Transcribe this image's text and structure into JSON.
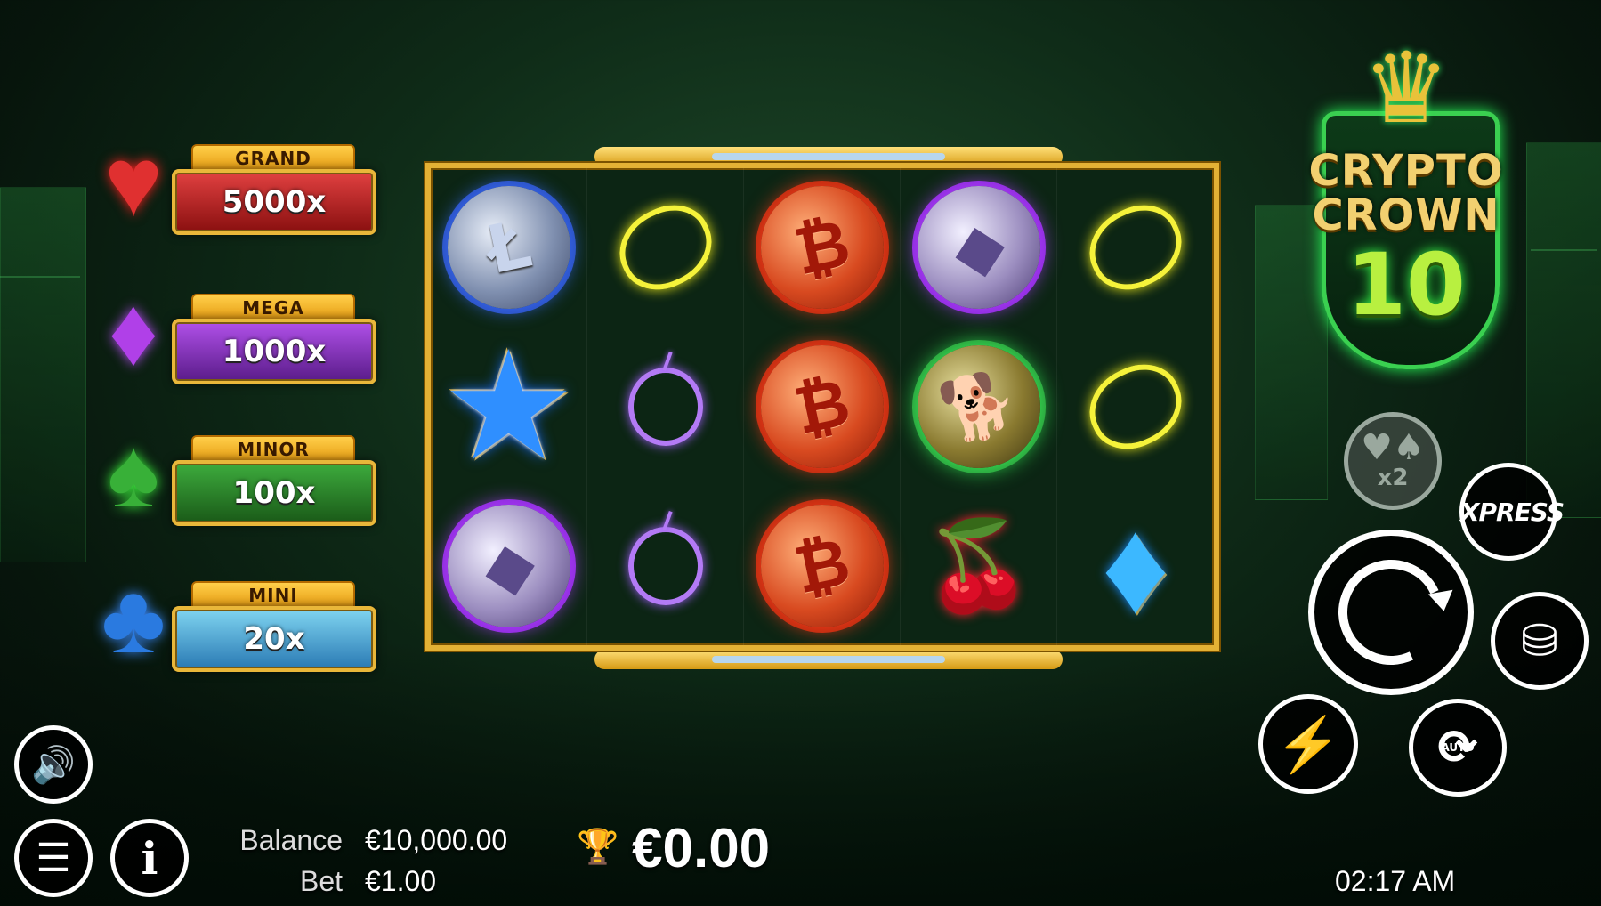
{
  "jackpots": [
    {
      "name": "GRAND",
      "value": "5000x",
      "suit": "♥",
      "color": "#e03030"
    },
    {
      "name": "MEGA",
      "value": "1000x",
      "suit": "♦",
      "color": "#b040e8"
    },
    {
      "name": "MINOR",
      "value": "100x",
      "suit": "♠",
      "color": "#38b038"
    },
    {
      "name": "MINI",
      "value": "20x",
      "suit": "♣",
      "color": "#2a7ae0"
    }
  ],
  "reels": [
    [
      "litecoin-coin",
      "star-symbol",
      "ethereum-coin"
    ],
    [
      "lemon-symbol",
      "plum-symbol",
      "plum-symbol"
    ],
    [
      "bitcoin-coin",
      "bitcoin-coin",
      "bitcoin-coin"
    ],
    [
      "ethereum-coin",
      "dogecoin-coin",
      "cherry-symbol"
    ],
    [
      "lemon-symbol",
      "lemon-symbol",
      "diamond-symbol"
    ]
  ],
  "logo": {
    "line1": "CRYPTO",
    "line2": "CROWN",
    "number": "10"
  },
  "controls": {
    "double_up": "x2",
    "xpress": "XPRESS",
    "auto": "AUTO"
  },
  "status": {
    "balance_label": "Balance",
    "balance_value": "€10,000.00",
    "bet_label": "Bet",
    "bet_value": "€1.00",
    "win_value": "€0.00",
    "clock": "02:17 AM"
  },
  "icons": [
    "sound-icon",
    "menu-icon",
    "info-icon",
    "trophy-icon",
    "spin-icon",
    "coins-stack-icon",
    "lightning-icon",
    "autoplay-icon",
    "double-up-icon"
  ]
}
